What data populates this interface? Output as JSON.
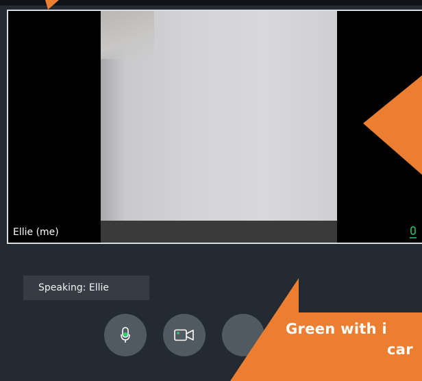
{
  "video_tile": {
    "participant_name": "Ellie (me)"
  },
  "status": {
    "speaking_text": "Speaking: Ellie"
  },
  "controls": [
    {
      "name": "microphone-toggle",
      "icon": "microphone-icon",
      "state": "active",
      "indicator_color": "#2ecc71"
    },
    {
      "name": "camera-toggle",
      "icon": "video-camera-icon",
      "state": "active",
      "indicator_color": "#2ecc71"
    },
    {
      "name": "third-control",
      "icon": "unknown-icon"
    }
  ],
  "annotations": {
    "line1": "Green with i",
    "line2": "car"
  },
  "colors": {
    "annotation_orange": "#ec7e32",
    "active_green": "#2ecc71",
    "control_button_bg": "#525a61",
    "toolbar_bg": "#232a31"
  }
}
